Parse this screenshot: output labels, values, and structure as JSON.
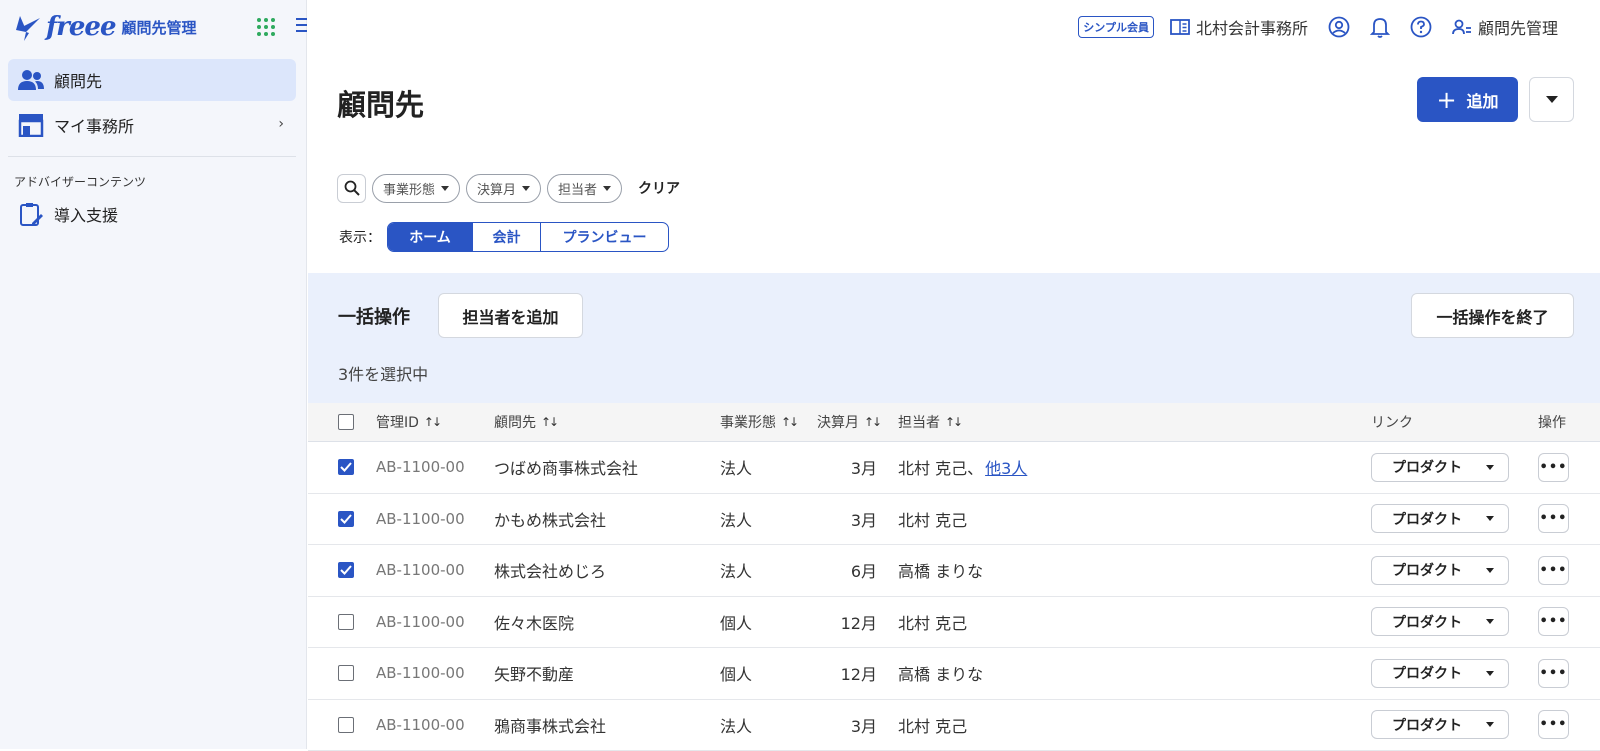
{
  "app": {
    "brand": "freee",
    "app_name": "顧問先管理"
  },
  "sidebar": {
    "items": [
      {
        "label": "顧問先",
        "icon": "users-icon",
        "active": true
      },
      {
        "label": "マイ事務所",
        "icon": "store-icon",
        "active": false
      }
    ],
    "section_label": "アドバイザーコンテンツ",
    "section_items": [
      {
        "label": "導入支援",
        "icon": "clipboard-edit-icon"
      }
    ]
  },
  "topbar": {
    "plan_badge": "シンプル会員",
    "office": "北村会計事務所",
    "account_label": "顧問先管理"
  },
  "page": {
    "title": "顧問先",
    "add_label": "追加"
  },
  "filters": {
    "chips": [
      "事業形態",
      "決算月",
      "担当者"
    ],
    "clear_label": "クリア"
  },
  "view": {
    "label": "表示：",
    "options": [
      "ホーム",
      "会計",
      "プランビュー"
    ],
    "selected": "ホーム"
  },
  "bulk": {
    "title": "一括操作",
    "add_assignee_label": "担当者を追加",
    "end_label": "一括操作を終了",
    "selected_count": "3件を選択中"
  },
  "table": {
    "columns": {
      "id": "管理ID",
      "client": "顧問先",
      "type": "事業形態",
      "month": "決算月",
      "assignee": "担当者",
      "link": "リンク",
      "ops": "操作"
    },
    "product_label": "プロダクト",
    "rows": [
      {
        "checked": true,
        "id": "AB-1100-00",
        "client": "つばめ商事株式会社",
        "type": "法人",
        "month": "3月",
        "assignee": "北村 克己、",
        "more": "他3人"
      },
      {
        "checked": true,
        "id": "AB-1100-00",
        "client": "かもめ株式会社",
        "type": "法人",
        "month": "3月",
        "assignee": "北村 克己",
        "more": ""
      },
      {
        "checked": true,
        "id": "AB-1100-00",
        "client": "株式会社めじろ",
        "type": "法人",
        "month": "6月",
        "assignee": "高橋 まりな",
        "more": ""
      },
      {
        "checked": false,
        "id": "AB-1100-00",
        "client": "佐々木医院",
        "type": "個人",
        "month": "12月",
        "assignee": "北村 克己",
        "more": ""
      },
      {
        "checked": false,
        "id": "AB-1100-00",
        "client": "矢野不動産",
        "type": "個人",
        "month": "12月",
        "assignee": "高橋 まりな",
        "more": ""
      },
      {
        "checked": false,
        "id": "AB-1100-00",
        "client": "鴉商事株式会社",
        "type": "法人",
        "month": "3月",
        "assignee": "北村 克己",
        "more": ""
      }
    ]
  },
  "colors": {
    "accent": "#2a55c4",
    "sidebar_bg": "#f4f6fb",
    "bulk_bg": "#eaf0fc",
    "active_nav": "#dce6fb"
  }
}
